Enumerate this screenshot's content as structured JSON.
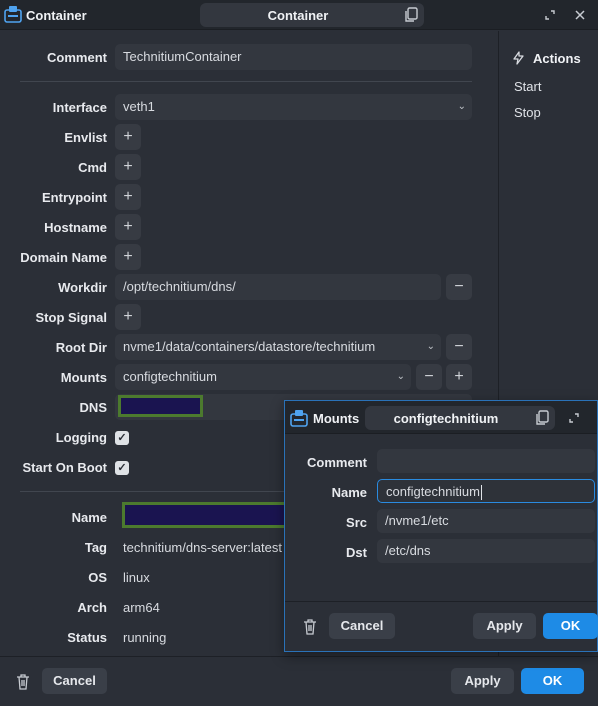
{
  "window": {
    "app_title": "Container",
    "title": "Container"
  },
  "form": {
    "comment_label": "Comment",
    "comment_value": "TechnitiumContainer",
    "interface_label": "Interface",
    "interface_value": "veth1",
    "envlist_label": "Envlist",
    "cmd_label": "Cmd",
    "entrypoint_label": "Entrypoint",
    "hostname_label": "Hostname",
    "domain_label": "Domain Name",
    "workdir_label": "Workdir",
    "workdir_value": "/opt/technitium/dns/",
    "stop_signal_label": "Stop Signal",
    "root_dir_label": "Root Dir",
    "root_dir_value": "nvme1/data/containers/datastore/technitium",
    "mounts_label": "Mounts",
    "mounts_value": "configtechnitium",
    "dns_label": "DNS",
    "logging_label": "Logging",
    "logging_checked": true,
    "start_on_boot_label": "Start On Boot",
    "start_on_boot_checked": true,
    "add_symbol": "+",
    "remove_symbol": "−"
  },
  "info": {
    "name_label": "Name",
    "tag_label": "Tag",
    "tag_value": "technitium/dns-server:latest",
    "os_label": "OS",
    "os_value": "linux",
    "arch_label": "Arch",
    "arch_value": "arm64",
    "status_label": "Status",
    "status_value": "running"
  },
  "actions": {
    "title": "Actions",
    "items": [
      "Start",
      "Stop"
    ]
  },
  "footer": {
    "cancel": "Cancel",
    "apply": "Apply",
    "ok": "OK"
  },
  "mounts_dialog": {
    "title": "Mounts",
    "pill_title": "configtechnitium",
    "comment_label": "Comment",
    "comment_value": "",
    "name_label": "Name",
    "name_value": "configtechnitium",
    "src_label": "Src",
    "src_value": "/nvme1/etc",
    "dst_label": "Dst",
    "dst_value": "/etc/dns",
    "cancel": "Cancel",
    "apply": "Apply",
    "ok": "OK"
  },
  "colors": {
    "accent": "#1e8be6",
    "background": "#2b2f37",
    "field": "#33373f",
    "redaction_fill": "#1a1450",
    "redaction_border": "#4c7a2e"
  },
  "icons": [
    "container-app-icon",
    "copy-icon",
    "expand-icon",
    "close-icon",
    "chevron-down-icon",
    "lightning-icon",
    "trash-icon",
    "check-icon"
  ]
}
